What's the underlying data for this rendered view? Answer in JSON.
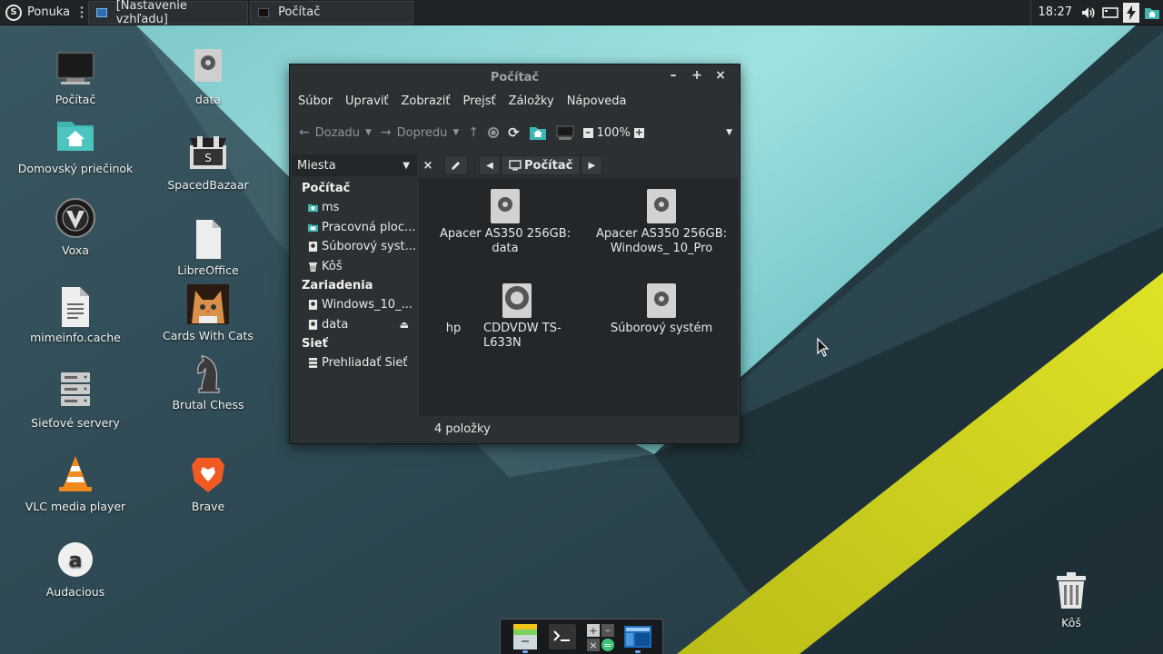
{
  "top_panel": {
    "menu_label": "Ponuka",
    "tasks": [
      {
        "label": "[Nastavenie vzhľadu]"
      },
      {
        "label": "Počítač"
      }
    ],
    "clock": "18:27"
  },
  "desktop": {
    "icons": [
      {
        "label": "Počítač"
      },
      {
        "label": "data"
      },
      {
        "label": "Domovský priečinok"
      },
      {
        "label": "SpacedBazaar"
      },
      {
        "label": "Voxa"
      },
      {
        "label": "LibreOffice"
      },
      {
        "label": "mimeinfo.cache"
      },
      {
        "label": "Cards With Cats"
      },
      {
        "label": "Sieťové servery"
      },
      {
        "label": "Brutal Chess"
      },
      {
        "label": "VLC media player"
      },
      {
        "label": "Brave"
      },
      {
        "label": "Audacious"
      },
      {
        "label": "Kôš"
      }
    ]
  },
  "window": {
    "title": "Počítač",
    "controls": {
      "minimize": "–",
      "maximize": "+",
      "close": "×"
    },
    "menu": [
      "Súbor",
      "Upraviť",
      "Zobraziť",
      "Prejsť",
      "Záložky",
      "Nápoveda"
    ],
    "toolbar": {
      "back": "Dozadu",
      "forward": "Dopredu",
      "zoom": "100%"
    },
    "places_label": "Miesta",
    "path_current": "Počítač",
    "sidebar": {
      "sections": [
        {
          "title": "Počítač",
          "items": [
            "ms",
            "Pracovná ploc...",
            "Súborový syst...",
            "Kôš"
          ]
        },
        {
          "title": "Zariadenia",
          "items": [
            "Windows_10_...",
            "data"
          ]
        },
        {
          "title": "Sieť",
          "items": [
            "Prehliadať Sieť"
          ]
        }
      ]
    },
    "files": [
      {
        "label": "Apacer AS350 256GB: data"
      },
      {
        "label": "Apacer AS350 256GB: Windows_ 10_Pro"
      },
      {
        "label": "hp"
      },
      {
        "label": "CDDVDW TS- L633N"
      },
      {
        "label": "Súborový systém"
      }
    ],
    "status": "4 položky"
  },
  "colors": {
    "panel": "#1f2326",
    "window_bg": "#2b3033",
    "content_bg": "#23272a",
    "folder_teal": "#3fb6b2",
    "wallpaper_yellow": "#d7dc1c",
    "wallpaper_cyan": "#8fd9d8"
  }
}
